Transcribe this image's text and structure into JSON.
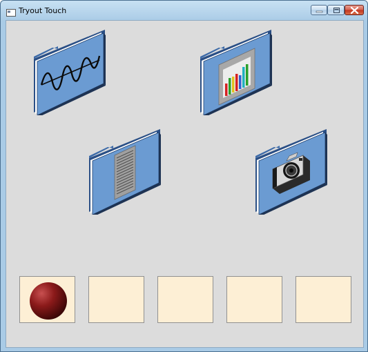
{
  "window": {
    "title": "Tryout Touch",
    "app_icon": "window-app-icon",
    "buttons": {
      "minimize": "minimize-icon",
      "maximize": "maximize-icon",
      "close": "close-icon"
    }
  },
  "folders": [
    {
      "name": "folder-waveform",
      "icon": "waveform-icon"
    },
    {
      "name": "folder-chart",
      "icon": "bar-chart-icon"
    },
    {
      "name": "folder-document",
      "icon": "document-icon"
    },
    {
      "name": "folder-camera",
      "icon": "camera-icon"
    }
  ],
  "slots": [
    {
      "name": "drop-slot-1",
      "contains": "red-ball"
    },
    {
      "name": "drop-slot-2",
      "contains": null
    },
    {
      "name": "drop-slot-3",
      "contains": null
    },
    {
      "name": "drop-slot-4",
      "contains": null
    },
    {
      "name": "drop-slot-5",
      "contains": null
    }
  ],
  "colors": {
    "folder_blue": "#6b9bd2",
    "slot_fill": "#fdefd5",
    "client_bg": "#dcdcdc",
    "ball": "#8b1a1a"
  }
}
